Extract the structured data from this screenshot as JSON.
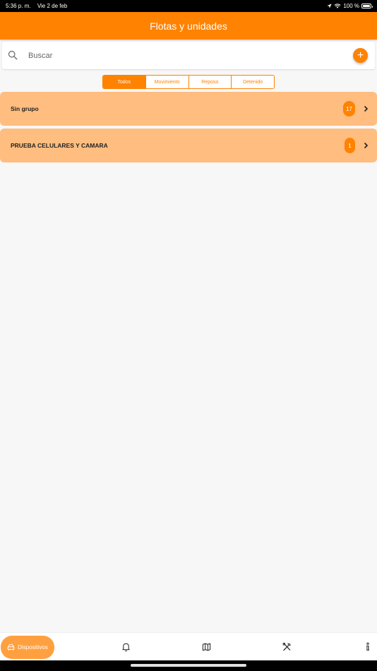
{
  "status_bar": {
    "time": "5:36 p. m.",
    "date": "Vie 2 de feb",
    "battery": "100 %",
    "battery_level": 1.0
  },
  "header": {
    "title": "Flotas y unidades"
  },
  "search": {
    "placeholder": "Buscar",
    "value": ""
  },
  "filters": [
    {
      "label": "Todos",
      "active": true
    },
    {
      "label": "Movimiento",
      "active": false
    },
    {
      "label": "Reposo",
      "active": false
    },
    {
      "label": "Detenido",
      "active": false
    }
  ],
  "groups": [
    {
      "name": "Sin grupo",
      "count": "17"
    },
    {
      "name": "PRUEBA CELULARES Y CAMARA",
      "count": "1"
    }
  ],
  "bottom_nav": {
    "active_label": "Dispositivos"
  },
  "colors": {
    "accent": "#ff8200",
    "row_background": "#ffbd80",
    "page_background": "#f7f7f7"
  }
}
